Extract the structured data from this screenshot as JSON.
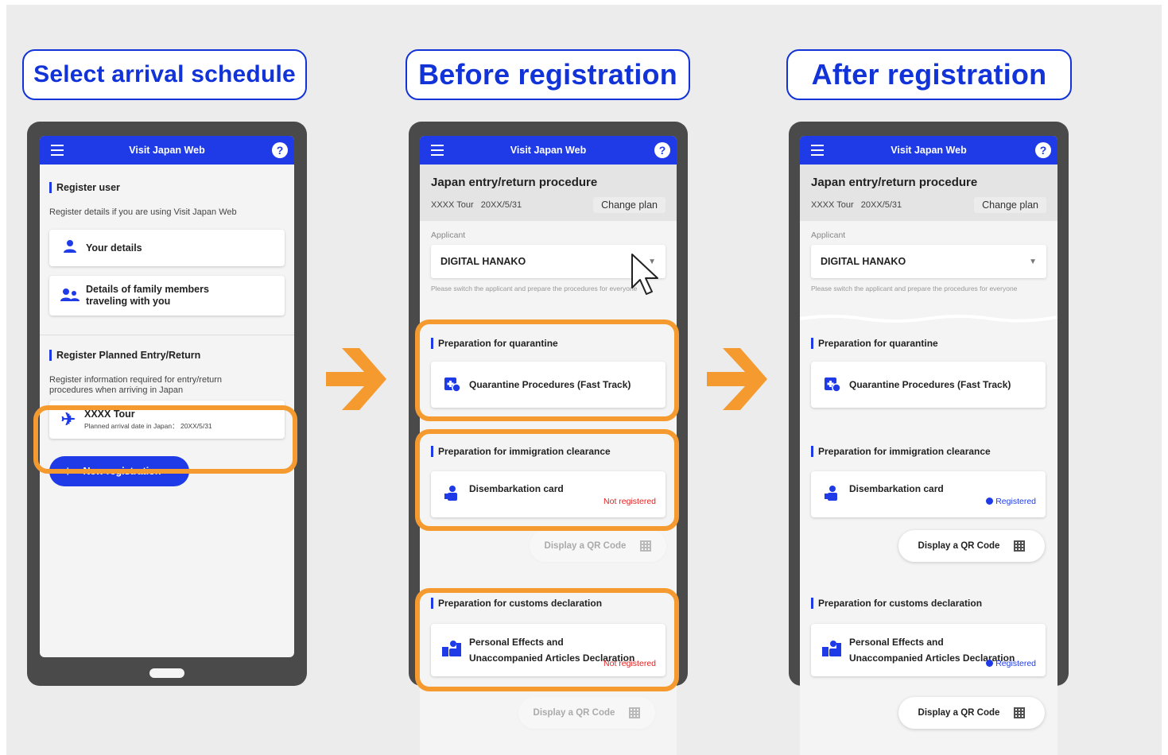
{
  "titles": {
    "step1": "Select arrival schedule",
    "step2": "Before registration",
    "step3": "After registration"
  },
  "app": {
    "name": "Visit Japan Web",
    "help": "?"
  },
  "phone1": {
    "register_user_label": "Register user",
    "register_user_desc": "Register details if you are using Visit Japan Web",
    "your_details": "Your details",
    "family_line1": "Details of family members",
    "family_line2": "traveling with you",
    "planned_label": "Register Planned Entry/Return",
    "planned_desc_line1": "Register information required for entry/return",
    "planned_desc_line2": "procedures when arriving in Japan",
    "tour_name": "XXXX Tour",
    "tour_date": "Planned arrival date in Japan： 20XX/5/31",
    "new_registration": "New registration"
  },
  "procedure": {
    "title": "Japan entry/return procedure",
    "tour": "XXXX Tour",
    "date": "20XX/5/31",
    "change_plan": "Change plan",
    "applicant_label": "Applicant",
    "applicant_name": "DIGITAL HANAKO",
    "note": "Please switch the applicant and prepare the procedures for everyone",
    "quarantine_label": "Preparation for quarantine",
    "quarantine_item": "Quarantine Procedures (Fast Track)",
    "immigration_label": "Preparation for immigration clearance",
    "disembarkation": "Disembarkation card",
    "customs_label": "Preparation for customs declaration",
    "customs_line1": "Personal Effects and",
    "customs_line2": "Unaccompanied Articles Declaration",
    "qr_button": "Display a QR Code",
    "status_not_registered": "Not registered",
    "status_registered": "Registered"
  },
  "colors": {
    "brand_blue": "#1f3be8",
    "highlight_orange": "#f59a2f",
    "status_red": "#e62020"
  },
  "icons": {
    "menu": "hamburger-menu-icon",
    "help": "help-circle-icon",
    "person": "person-icon",
    "family": "family-icon",
    "plane": "airplane-icon",
    "plus": "plus-icon",
    "quarantine": "medical-kit-icon",
    "immigration": "officer-icon",
    "customs": "luggage-icon",
    "qr": "qr-code-icon",
    "cursor": "mouse-pointer-icon",
    "arrow": "arrow-right-icon"
  }
}
